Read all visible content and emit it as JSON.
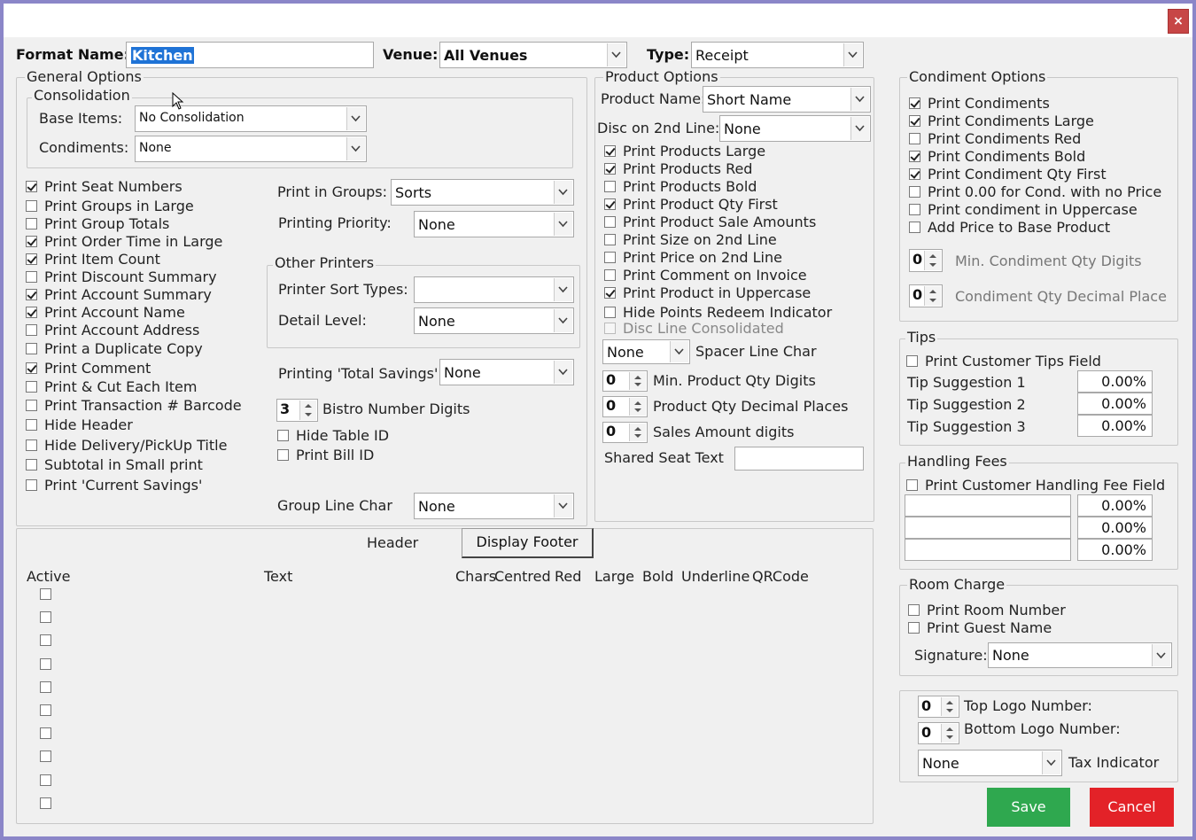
{
  "window": {
    "close_label": "×"
  },
  "top": {
    "format_name_label": "Format Name:",
    "format_name_value": "Kitchen",
    "venue_label": "Venue:",
    "venue_value": "All Venues",
    "type_label": "Type:",
    "type_value": "Receipt"
  },
  "general": {
    "legend": "General Options",
    "consolidation_legend": "Consolidation",
    "base_items_label": "Base Items:",
    "base_items_value": "No Consolidation",
    "condiments_label": "Condiments:",
    "condiments_value": "None",
    "checks": [
      {
        "label": "Print Seat Numbers",
        "checked": true
      },
      {
        "label": "Print Groups in Large",
        "checked": false
      },
      {
        "label": "Print Group Totals",
        "checked": false
      },
      {
        "label": "Print Order Time in Large",
        "checked": true
      },
      {
        "label": "Print Item Count",
        "checked": true
      },
      {
        "label": "Print Discount Summary",
        "checked": false
      },
      {
        "label": "Print Account Summary",
        "checked": true
      },
      {
        "label": "Print Account Name",
        "checked": true
      },
      {
        "label": "Print Account Address",
        "checked": false
      },
      {
        "label": "Print a Duplicate Copy",
        "checked": false
      },
      {
        "label": "Print Comment",
        "checked": true
      },
      {
        "label": "Print & Cut Each Item",
        "checked": false
      },
      {
        "label": "Print Transaction # Barcode",
        "checked": false
      },
      {
        "label": "Hide Header",
        "checked": false
      },
      {
        "label": "Hide Delivery/PickUp Title",
        "checked": false
      },
      {
        "label": "Subtotal in Small print",
        "checked": false
      },
      {
        "label": "Print 'Current Savings'",
        "checked": false
      }
    ],
    "print_in_groups_label": "Print in Groups:",
    "print_in_groups_value": "Sorts",
    "printing_priority_label": "Printing Priority:",
    "printing_priority_value": "None",
    "other_printers_legend": "Other Printers",
    "printer_sort_types_label": "Printer Sort Types:",
    "printer_sort_types_value": "",
    "detail_level_label": "Detail Level:",
    "detail_level_value": "None",
    "total_savings_label": "Printing 'Total Savings':",
    "total_savings_value": "None",
    "bistro_digits_value": "3",
    "bistro_digits_label": "Bistro Number Digits",
    "hide_table_id_label": "Hide Table ID",
    "print_bill_id_label": "Print Bill ID",
    "group_line_char_label": "Group Line Char",
    "group_line_char_value": "None"
  },
  "product": {
    "legend": "Product Options",
    "product_name_label": "Product Name:",
    "product_name_value": "Short Name",
    "disc_2nd_line_label": "Disc on 2nd Line:",
    "disc_2nd_line_value": "None",
    "checks": [
      {
        "label": "Print Products Large",
        "checked": true
      },
      {
        "label": "Print Products Red",
        "checked": true
      },
      {
        "label": "Print Products Bold",
        "checked": false
      },
      {
        "label": "Print Product Qty First",
        "checked": true
      },
      {
        "label": "Print Product Sale Amounts",
        "checked": false
      },
      {
        "label": "Print Size on 2nd Line",
        "checked": false
      },
      {
        "label": "Print Price on 2nd Line",
        "checked": false
      },
      {
        "label": "Print Comment on Invoice",
        "checked": false
      },
      {
        "label": "Print Product in Uppercase",
        "checked": true
      },
      {
        "label": "Hide Points Redeem Indicator",
        "checked": false
      }
    ],
    "disc_line_consolidated_label": "Disc Line Consolidated",
    "spacer_value": "None",
    "spacer_label": "Spacer Line Char",
    "min_qty_value": "0",
    "min_qty_label": "Min. Product Qty Digits",
    "qty_dec_value": "0",
    "qty_dec_label": "Product Qty Decimal Places",
    "sales_amt_value": "0",
    "sales_amt_label": "Sales Amount digits",
    "shared_seat_label": "Shared Seat Text",
    "shared_seat_value": ""
  },
  "lines": {
    "header_label": "Header",
    "footer_tab_label": "Display Footer",
    "col_active": "Active",
    "col_text": "Text",
    "col_chars": "Chars",
    "col_centred": "Centred",
    "col_red": "Red",
    "col_large": "Large",
    "col_bold": "Bold",
    "col_underline": "Underline",
    "col_qrcode": "QRCode"
  },
  "condiment": {
    "legend": "Condiment Options",
    "checks": [
      {
        "label": "Print Condiments",
        "checked": true
      },
      {
        "label": "Print Condiments Large",
        "checked": true
      },
      {
        "label": "Print Condiments Red",
        "checked": false
      },
      {
        "label": "Print Condiments Bold",
        "checked": true
      },
      {
        "label": "Print Condiment Qty First",
        "checked": true
      },
      {
        "label": "Print 0.00 for Cond. with no Price",
        "checked": false
      },
      {
        "label": "Print condiment in Uppercase",
        "checked": false
      },
      {
        "label": "Add Price to Base Product",
        "checked": false
      }
    ],
    "min_qty_value": "0",
    "min_qty_label": "Min. Condiment Qty Digits",
    "qty_dec_value": "0",
    "qty_dec_label": "Condiment Qty Decimal Place"
  },
  "tips": {
    "legend": "Tips",
    "print_field_label": "Print Customer Tips Field",
    "s1_label": "Tip Suggestion 1",
    "s1_value": "0.00%",
    "s2_label": "Tip Suggestion 2",
    "s2_value": "0.00%",
    "s3_label": "Tip Suggestion 3",
    "s3_value": "0.00%"
  },
  "handling": {
    "legend": "Handling Fees",
    "print_field_label": "Print Customer  Handling Fee Field",
    "v1": "0.00%",
    "v2": "0.00%",
    "v3": "0.00%"
  },
  "room": {
    "legend": "Room Charge",
    "print_room_label": "Print Room Number",
    "print_guest_label": "Print Guest Name",
    "signature_label": "Signature:",
    "signature_value": "None"
  },
  "logo": {
    "top_value": "0",
    "top_label": "Top Logo Number:",
    "bottom_value": "0",
    "bottom_label": "Bottom Logo Number:",
    "tax_value": "None",
    "tax_label": "Tax Indicator"
  },
  "actions": {
    "save_label": "Save",
    "cancel_label": "Cancel",
    "save_color": "#2fa84f",
    "cancel_color": "#e32228"
  }
}
